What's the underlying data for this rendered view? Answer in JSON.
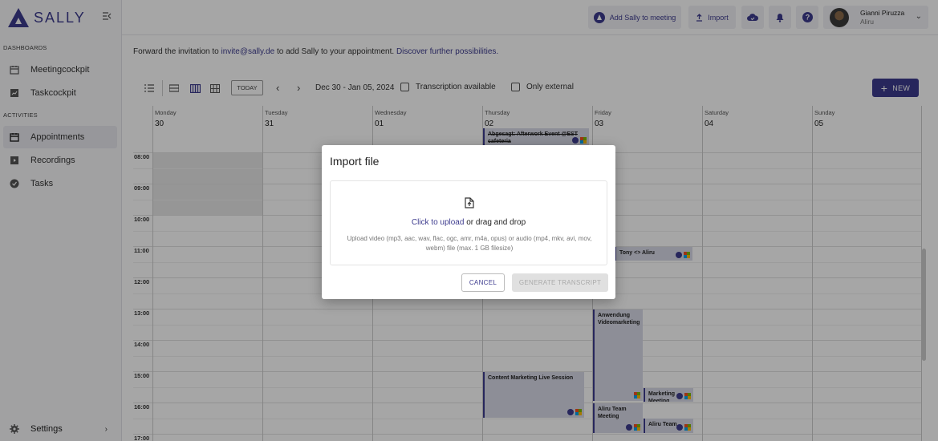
{
  "brand": {
    "name": "SALLY",
    "color": "#3d3b8e"
  },
  "sidebar": {
    "section_dashboards": "DASHBOARDS",
    "section_activities": "ACTIVITIES",
    "items": [
      {
        "label": "Meetingcockpit",
        "icon": "calendar-icon"
      },
      {
        "label": "Taskcockpit",
        "icon": "chart-icon"
      },
      {
        "label": "Appointments",
        "icon": "calendar-icon",
        "active": true
      },
      {
        "label": "Recordings",
        "icon": "recordings-icon"
      },
      {
        "label": "Tasks",
        "icon": "check-circle-icon"
      }
    ],
    "settings_label": "Settings"
  },
  "topbar": {
    "add_sally_label": "Add Sally to meeting",
    "import_label": "Import",
    "user_name": "Gianni Piruzza",
    "user_org": "Aliru"
  },
  "main": {
    "info_prefix": "Forward the invitation to ",
    "info_email": "invite@sally.de",
    "info_middle": " to add Sally to your appointment. ",
    "info_link": "Discover further possibilities.",
    "today_label": "TODAY",
    "date_range": "Dec 30 - Jan 05, 2024",
    "filter_transcription": "Transcription available",
    "filter_external": "Only external",
    "new_label": "NEW"
  },
  "calendar": {
    "days": [
      {
        "name": "Monday",
        "num": "30"
      },
      {
        "name": "Tuesday",
        "num": "31"
      },
      {
        "name": "Wednesday",
        "num": "01"
      },
      {
        "name": "Thursday",
        "num": "02"
      },
      {
        "name": "Friday",
        "num": "03"
      },
      {
        "name": "Saturday",
        "num": "04"
      },
      {
        "name": "Sunday",
        "num": "05"
      }
    ],
    "hours": [
      "08:00",
      "09:00",
      "10:00",
      "11:00",
      "12:00",
      "13:00",
      "14:00",
      "15:00",
      "16:00",
      "17:00"
    ],
    "events": [
      {
        "title": "Abgesagt: Afterwork Event @EST cafeteria"
      },
      {
        "title": "Tony <> Aliru"
      },
      {
        "title": "Anwendung Videomarketing"
      },
      {
        "title": "Content Marketing Live Session"
      },
      {
        "title": "Marketing Meeting"
      },
      {
        "title": "Aliru Team Meeting"
      },
      {
        "title": "Aliru Team"
      }
    ]
  },
  "dialog": {
    "title": "Import file",
    "click_to_upload": "Click to upload",
    "drag_drop": " or drag and drop",
    "hint": "Upload video (mp3, aac, wav, flac, ogc, amr, m4a, opus) or audio (mp4, mkv, avi, mov, webm) file (max. 1 GB filesize)",
    "cancel_label": "CANCEL",
    "generate_label": "GENERATE TRANSCRIPT"
  }
}
